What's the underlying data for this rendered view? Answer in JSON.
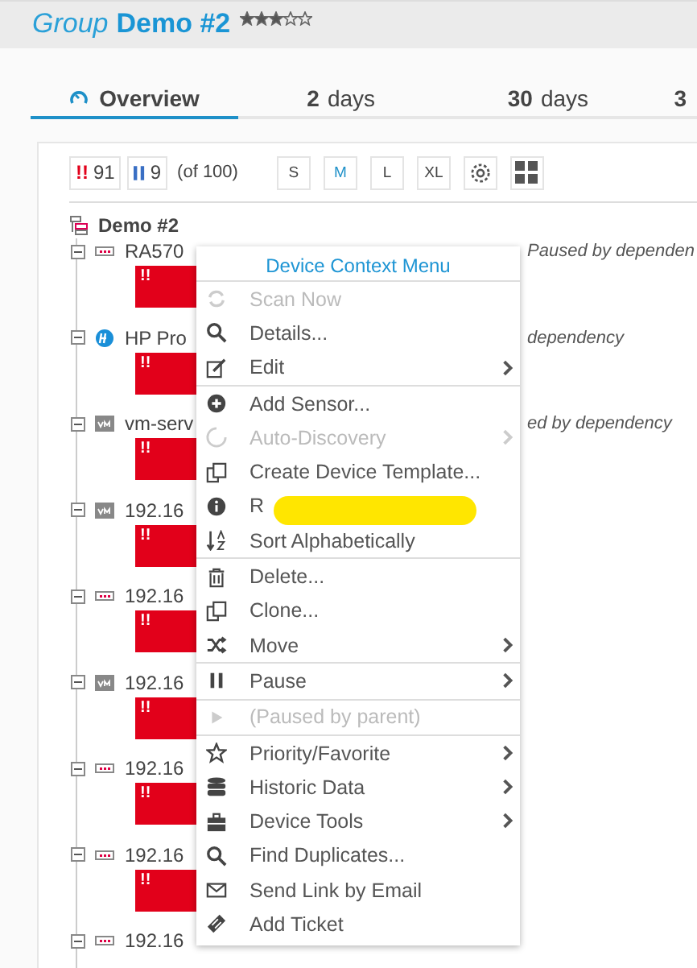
{
  "header": {
    "prefix": "Group",
    "title": "Demo #2",
    "stars": 3
  },
  "tabs": [
    {
      "label": "Overview",
      "selected": true
    },
    {
      "number": "2",
      "label": "days",
      "selected": false
    },
    {
      "number": "30",
      "label": "days",
      "selected": false
    },
    {
      "number": "3",
      "selected": false
    }
  ],
  "toolbar": {
    "down_mark": "!!",
    "down_count": "91",
    "paused_count": "9",
    "total": "(of 100)",
    "sizes": [
      {
        "label": "S",
        "selected": false
      },
      {
        "label": "M",
        "selected": true
      },
      {
        "label": "L",
        "selected": false
      },
      {
        "label": "XL",
        "selected": false
      }
    ]
  },
  "tree": {
    "root": "Demo #2",
    "children": [
      {
        "kind": "device",
        "name": "RA570",
        "status": "Paused by dependen",
        "sensor": "!!"
      },
      {
        "kind": "hp",
        "name": "HP Pro",
        "status": "dependency",
        "sensor": "!!"
      },
      {
        "kind": "vm",
        "name": "vm-serv",
        "status": "ed by dependency",
        "sensor": "!!"
      },
      {
        "kind": "vm",
        "name": "192.16",
        "sensor": "!!"
      },
      {
        "kind": "device",
        "name": "192.16",
        "sensor": "!!"
      },
      {
        "kind": "vm",
        "name": "192.16",
        "sensor": "!!"
      },
      {
        "kind": "device",
        "name": "192.16",
        "sensor": "!!"
      },
      {
        "kind": "device",
        "name": "192.16",
        "sensor": "!!"
      },
      {
        "kind": "device",
        "name": "192.16"
      }
    ]
  },
  "context_menu": {
    "title": "Device Context Menu",
    "items": [
      {
        "label": "Scan Now",
        "disabled": true,
        "submenu": false,
        "divider_before": false,
        "redacted": false
      },
      {
        "label": "Details...",
        "disabled": false,
        "submenu": false,
        "divider_before": false,
        "redacted": false
      },
      {
        "label": "Edit",
        "disabled": false,
        "submenu": true,
        "divider_before": false,
        "redacted": false
      },
      {
        "label": "Add Sensor...",
        "disabled": false,
        "submenu": false,
        "divider_before": true,
        "redacted": false
      },
      {
        "label": "Auto-Discovery",
        "disabled": true,
        "submenu": true,
        "divider_before": false,
        "redacted": false
      },
      {
        "label": "Create Device Template...",
        "disabled": false,
        "submenu": false,
        "divider_before": false,
        "redacted": false
      },
      {
        "label": "R",
        "disabled": false,
        "submenu": false,
        "divider_before": false,
        "redacted": true
      },
      {
        "label": "Sort Alphabetically",
        "disabled": false,
        "submenu": false,
        "divider_before": false,
        "redacted": false
      },
      {
        "label": "Delete...",
        "disabled": false,
        "submenu": false,
        "divider_before": true,
        "redacted": false
      },
      {
        "label": "Clone...",
        "disabled": false,
        "submenu": false,
        "divider_before": false,
        "redacted": false
      },
      {
        "label": "Move",
        "disabled": false,
        "submenu": true,
        "divider_before": false,
        "redacted": false
      },
      {
        "label": "Pause",
        "disabled": false,
        "submenu": true,
        "divider_before": true,
        "redacted": false
      },
      {
        "label": "(Paused by parent)",
        "disabled": true,
        "submenu": false,
        "divider_before": true,
        "redacted": false
      },
      {
        "label": "Priority/Favorite",
        "disabled": false,
        "submenu": true,
        "divider_before": true,
        "redacted": false
      },
      {
        "label": "Historic Data",
        "disabled": false,
        "submenu": true,
        "divider_before": false,
        "redacted": false
      },
      {
        "label": "Device Tools",
        "disabled": false,
        "submenu": true,
        "divider_before": false,
        "redacted": false
      },
      {
        "label": "Find Duplicates...",
        "disabled": false,
        "submenu": false,
        "divider_before": false,
        "redacted": false
      },
      {
        "label": "Send Link by Email",
        "disabled": false,
        "submenu": false,
        "divider_before": false,
        "redacted": false
      },
      {
        "label": "Add Ticket",
        "disabled": false,
        "submenu": false,
        "divider_before": false,
        "redacted": false
      }
    ]
  }
}
